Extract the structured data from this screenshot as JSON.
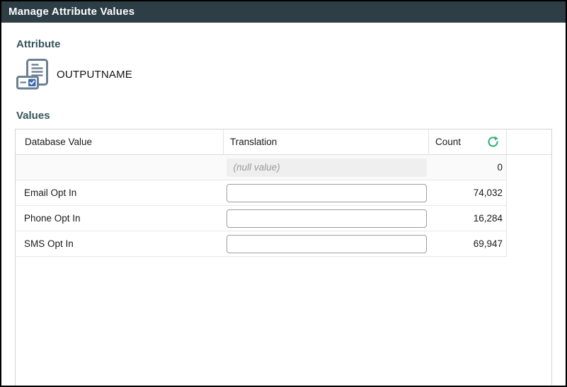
{
  "titlebar": {
    "title": "Manage Attribute Values"
  },
  "attribute": {
    "section_label": "Attribute",
    "name": "OUTPUTNAME"
  },
  "values": {
    "section_label": "Values",
    "columns": {
      "database_value": "Database Value",
      "translation": "Translation",
      "count": "Count"
    },
    "rows": [
      {
        "database_value": "",
        "translation_display": "(null value)",
        "count": "0"
      },
      {
        "database_value": "Email Opt In",
        "translation_value": "",
        "count": "74,032"
      },
      {
        "database_value": "Phone Opt In",
        "translation_value": "",
        "count": "16,284"
      },
      {
        "database_value": "SMS Opt In",
        "translation_value": "",
        "count": "69,947"
      }
    ]
  },
  "colors": {
    "titlebar_bg": "#2d3e46",
    "section_label": "#35535e",
    "refresh_green": "#27b46e",
    "attribute_icon_gray": "#6b8090",
    "attribute_icon_check_blue": "#3d6cb4"
  }
}
